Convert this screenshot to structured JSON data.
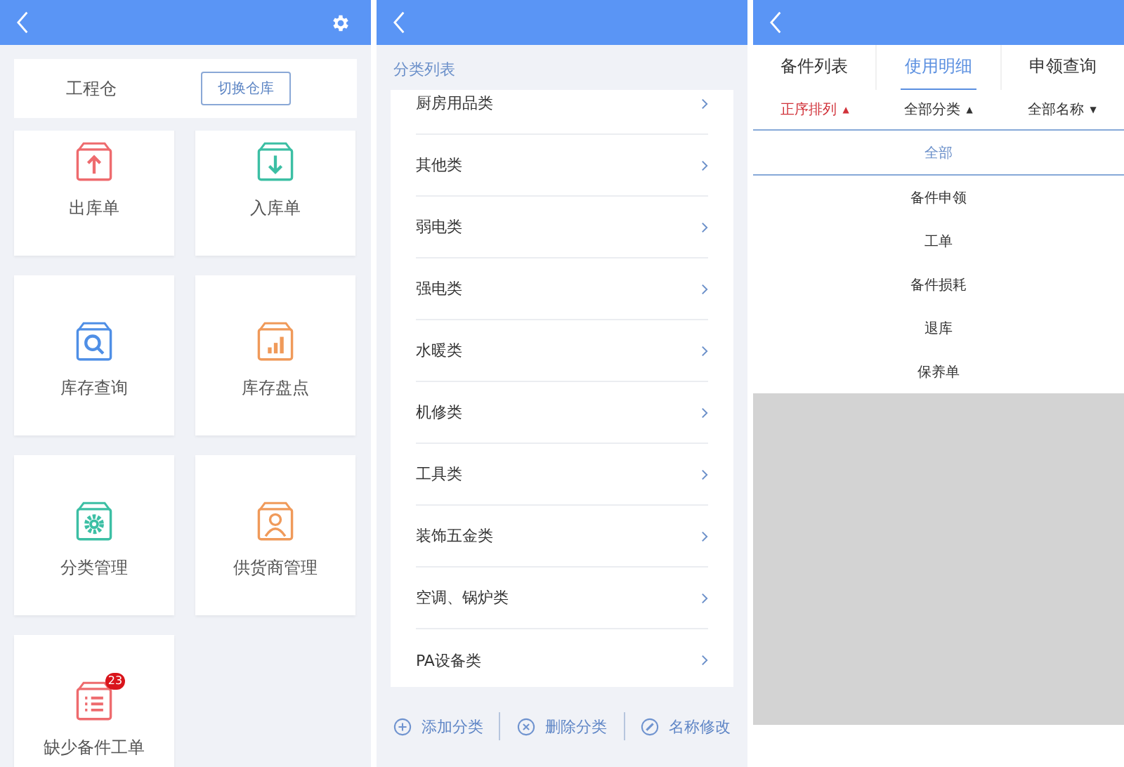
{
  "warehouse_home": {
    "warehouse": {
      "name": "工程仓",
      "switch_button": "切换仓库"
    },
    "tiles": [
      {
        "label": "出库单",
        "kind": "up",
        "color": "#ee6b6e"
      },
      {
        "label": "入库单",
        "kind": "down",
        "color": "#3cbfa4"
      },
      {
        "label": "库存查询",
        "kind": "search",
        "color": "#4f8fe6"
      },
      {
        "label": "库存盘点",
        "kind": "chart",
        "color": "#f09a5a"
      },
      {
        "label": "分类管理",
        "kind": "gear",
        "color": "#3cbfa4"
      },
      {
        "label": "供货商管理",
        "kind": "person",
        "color": "#f09a5a"
      },
      {
        "label": "缺少备件工单",
        "kind": "list",
        "color": "#ee6b6e",
        "badge": "23"
      }
    ]
  },
  "category_list": {
    "title": "分类列表",
    "items": [
      "厨房用品类",
      "其他类",
      "弱电类",
      "强电类",
      "水暖类",
      "机修类",
      "工具类",
      "装饰五金类",
      "空调、锅炉类",
      "PA设备类"
    ],
    "actions": [
      {
        "label": "添加分类",
        "kind": "add"
      },
      {
        "label": "删除分类",
        "kind": "delete"
      },
      {
        "label": "名称修改",
        "kind": "edit"
      }
    ]
  },
  "usage_detail": {
    "tabs": [
      {
        "label": "备件列表",
        "selected": false
      },
      {
        "label": "使用明细",
        "selected": true
      },
      {
        "label": "申领查询",
        "selected": false
      }
    ],
    "filters": [
      {
        "label": "正序排列",
        "arrow": "▲",
        "selected": true
      },
      {
        "label": "全部分类",
        "arrow": "▲",
        "selected": false
      },
      {
        "label": "全部名称",
        "arrow": "▼",
        "selected": false
      }
    ],
    "options": [
      {
        "label": "全部",
        "selected": true
      },
      {
        "label": "备件申领",
        "selected": false
      },
      {
        "label": "工单",
        "selected": false
      },
      {
        "label": "备件损耗",
        "selected": false
      },
      {
        "label": "退库",
        "selected": false
      },
      {
        "label": "保养单",
        "selected": false
      }
    ]
  }
}
